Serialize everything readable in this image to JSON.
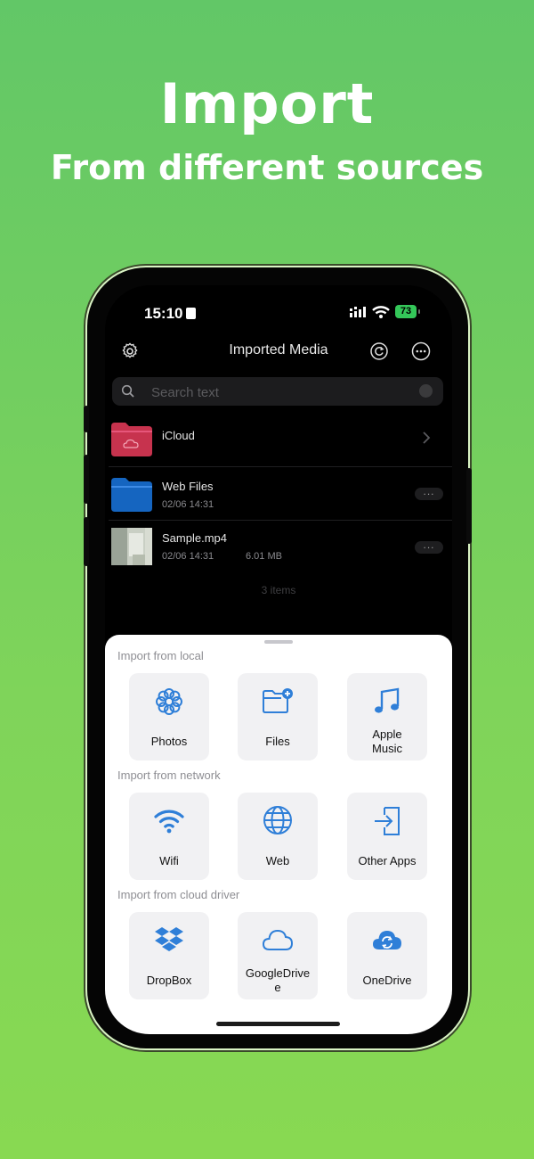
{
  "hero": {
    "title": "Import",
    "subtitle": "From different sources"
  },
  "status": {
    "time": "15:10",
    "battery": "73"
  },
  "nav": {
    "title": "Imported Media",
    "settings_icon": "gear-icon",
    "sync_icon": "refresh-icon",
    "more_icon": "ellipsis-circle-icon"
  },
  "search": {
    "placeholder": "Search text",
    "value": ""
  },
  "files": [
    {
      "name": "iCloud",
      "icon": "icloud-folder-icon",
      "color": "#c7334e"
    },
    {
      "name": "Web Files",
      "date": "02/06 14:31",
      "icon": "folder-icon",
      "color": "#1565c0"
    },
    {
      "name": "Sample.mp4",
      "date": "02/06 14:31",
      "size": "6.01 MB",
      "icon": "video-thumbnail"
    }
  ],
  "items_count": "3 items",
  "import": {
    "local": {
      "label": "Import from local",
      "options": [
        "Photos",
        "Files",
        "Apple\nMusic"
      ]
    },
    "network": {
      "label": "Import from network",
      "options": [
        "Wifi",
        "Web",
        "Other Apps"
      ]
    },
    "cloud": {
      "label": "Import from cloud driver",
      "options": [
        "DropBox",
        "GoogleDrive\ne",
        "OneDrive"
      ]
    }
  },
  "colors": {
    "accent": "#2f7fd8",
    "background": "#6ccf5e"
  }
}
